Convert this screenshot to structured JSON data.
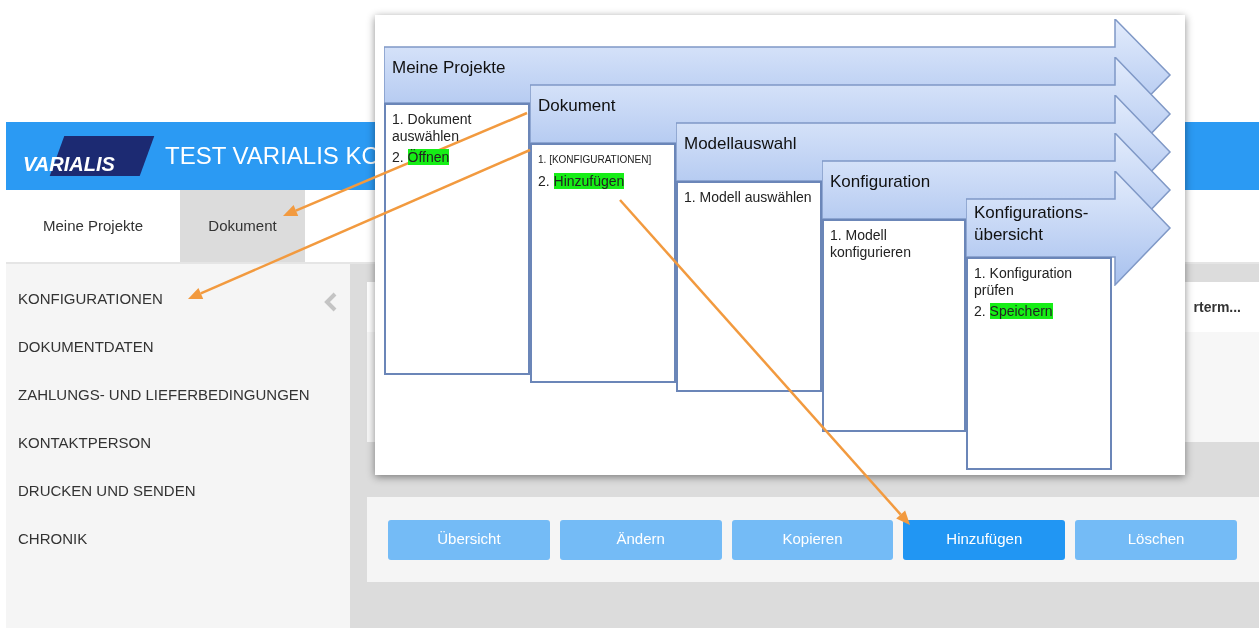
{
  "header": {
    "logo": "VARIALIS",
    "title": "TEST VARIALIS KO"
  },
  "tabs": [
    {
      "label": "Meine Projekte",
      "selected": false
    },
    {
      "label": "Dokument",
      "selected": true
    }
  ],
  "sidebar": {
    "items": [
      {
        "label": "KONFIGURATIONEN"
      },
      {
        "label": "DOKUMENTDATEN"
      },
      {
        "label": "ZAHLUNGS- UND LIEFERBEDINGUNGEN"
      },
      {
        "label": "KONTAKTPERSON"
      },
      {
        "label": "DRUCKEN UND SENDEN"
      },
      {
        "label": "CHRONIK"
      }
    ]
  },
  "table": {
    "column_text": "rterm..."
  },
  "buttons": [
    {
      "label": "Übersicht",
      "selected": false
    },
    {
      "label": "Ändern",
      "selected": false
    },
    {
      "label": "Kopieren",
      "selected": false
    },
    {
      "label": "Hinzufügen",
      "selected": true
    },
    {
      "label": "Löschen",
      "selected": false
    }
  ],
  "diagram": {
    "stages": [
      {
        "title": "Meine Projekte",
        "steps": [
          {
            "kind": "normal",
            "number": "1.",
            "text": "Dokument auswählen",
            "highlighted": false
          },
          {
            "kind": "normal",
            "number": "2.",
            "text": "Öffnen",
            "highlighted": true
          }
        ]
      },
      {
        "title": "Dokument",
        "steps": [
          {
            "kind": "reference",
            "number": "1.",
            "text": "[KONFIGURATIONEN]",
            "highlighted": false
          },
          {
            "kind": "normal",
            "number": "2.",
            "text": "Hinzufügen",
            "highlighted": true
          }
        ]
      },
      {
        "title": "Modellauswahl",
        "steps": [
          {
            "kind": "normal",
            "number": "1.",
            "text": "Modell auswählen",
            "highlighted": false
          }
        ]
      },
      {
        "title": "Konfiguration",
        "steps": [
          {
            "kind": "normal",
            "number": "1.",
            "text": "Modell konfigurieren",
            "highlighted": false
          }
        ]
      },
      {
        "title": "Konfigurations-übersicht",
        "steps": [
          {
            "kind": "normal",
            "number": "1.",
            "text": "Konfiguration prüfen",
            "highlighted": false
          },
          {
            "kind": "normal",
            "number": "2.",
            "text": "Speichern",
            "highlighted": true
          }
        ]
      }
    ]
  }
}
